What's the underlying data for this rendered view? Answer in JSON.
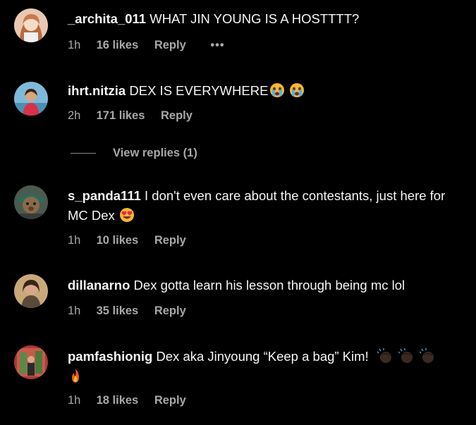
{
  "comments": [
    {
      "username": "_archita_011",
      "text": "WHAT JIN YOUNG IS A HOSTTTT?",
      "time": "1h",
      "likes": "16 likes",
      "reply": "Reply",
      "more": "•••"
    },
    {
      "username": "ihrt.nitzia",
      "text": "DEX IS EVERYWHERE",
      "emojis": [
        "crying-face-emoji",
        "crying-face-emoji"
      ],
      "time": "2h",
      "likes": "171 likes",
      "reply": "Reply",
      "view_replies": "View replies (1)"
    },
    {
      "username": "s_panda111",
      "text": "I don't even care about the contestants, just here for MC Dex",
      "emojis": [
        "heart-eyes-emoji"
      ],
      "time": "1h",
      "likes": "10 likes",
      "reply": "Reply"
    },
    {
      "username": "dillanarno",
      "text": "Dex gotta learn his lesson through being mc lol",
      "time": "1h",
      "likes": "35 likes",
      "reply": "Reply"
    },
    {
      "username": "pamfashionig",
      "text": "Dex aka Jinyoung “Keep a bag” Kim!",
      "emojis": [
        "clapping-hands-emoji",
        "clapping-hands-emoji",
        "clapping-hands-emoji",
        "fire-emoji"
      ],
      "time": "1h",
      "likes": "18 likes",
      "reply": "Reply"
    }
  ],
  "colors": {
    "background": "#000000",
    "text": "#f5f5f5",
    "muted": "#a8a8a8"
  }
}
